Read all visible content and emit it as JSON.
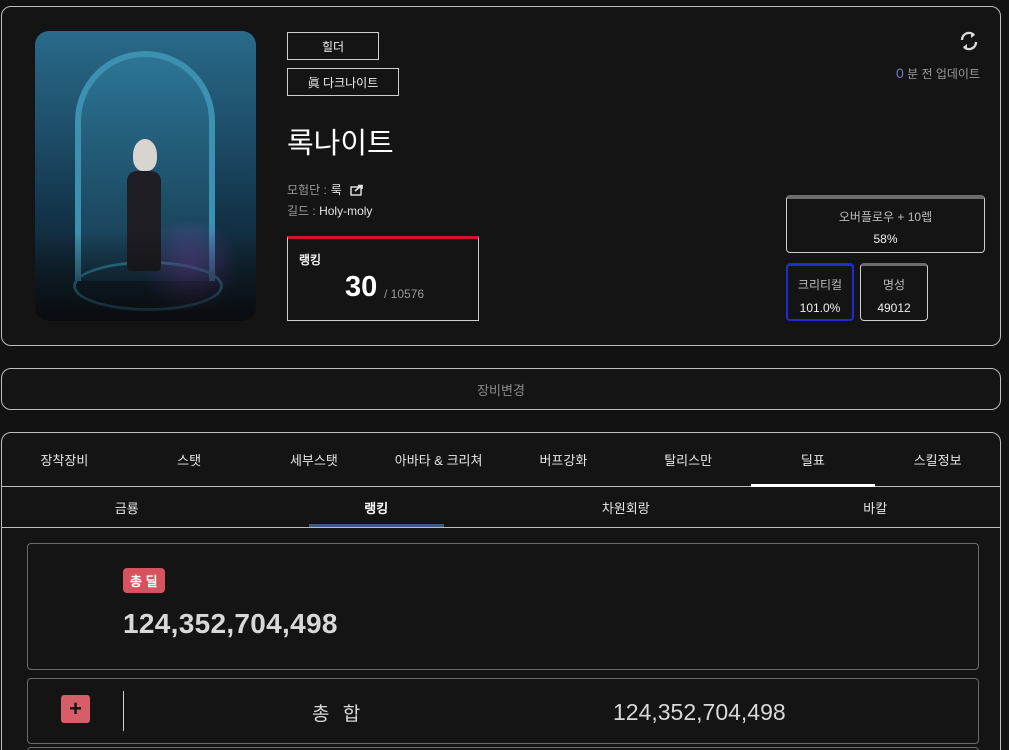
{
  "profile": {
    "server": "힐더",
    "class": "眞 다크나이트",
    "name": "록나이트",
    "adventure_label": "모험단 : ",
    "adventure_value": "룩",
    "guild_label": "길드 : ",
    "guild_value": "Holy-moly",
    "ranking_label": "랭킹",
    "ranking_value": "30",
    "ranking_total": "/ 10576",
    "update_count": "0",
    "update_text": " 분 전 업데이트",
    "overflow_title": "오버플로우 + 10렙",
    "overflow_value": "58%",
    "crit_title": "크리티컬",
    "crit_value": "101.0%",
    "fame_title": "명성",
    "fame_value": "49012",
    "colors": {
      "rank_accent": "#d3112a",
      "crit_border": "#1f2dd0",
      "update_number": "#6d7fc4"
    }
  },
  "change_equip_label": "장비변경",
  "main_tabs": [
    "장착장비",
    "스탯",
    "세부스탯",
    "아바타 & 크리쳐",
    "버프강화",
    "탈리스만",
    "딜표",
    "스킬정보"
  ],
  "active_main_tab": "딜표",
  "sub_tabs": [
    "금룡",
    "랭킹",
    "차원회랑",
    "바칼"
  ],
  "active_sub_tab": "랭킹",
  "deal": {
    "badge": "총 딜",
    "value": "124,352,704,498",
    "badge_color": "#d6525e"
  },
  "sum": {
    "plus": "+",
    "label": "총 합",
    "value": "124,352,704,498"
  }
}
